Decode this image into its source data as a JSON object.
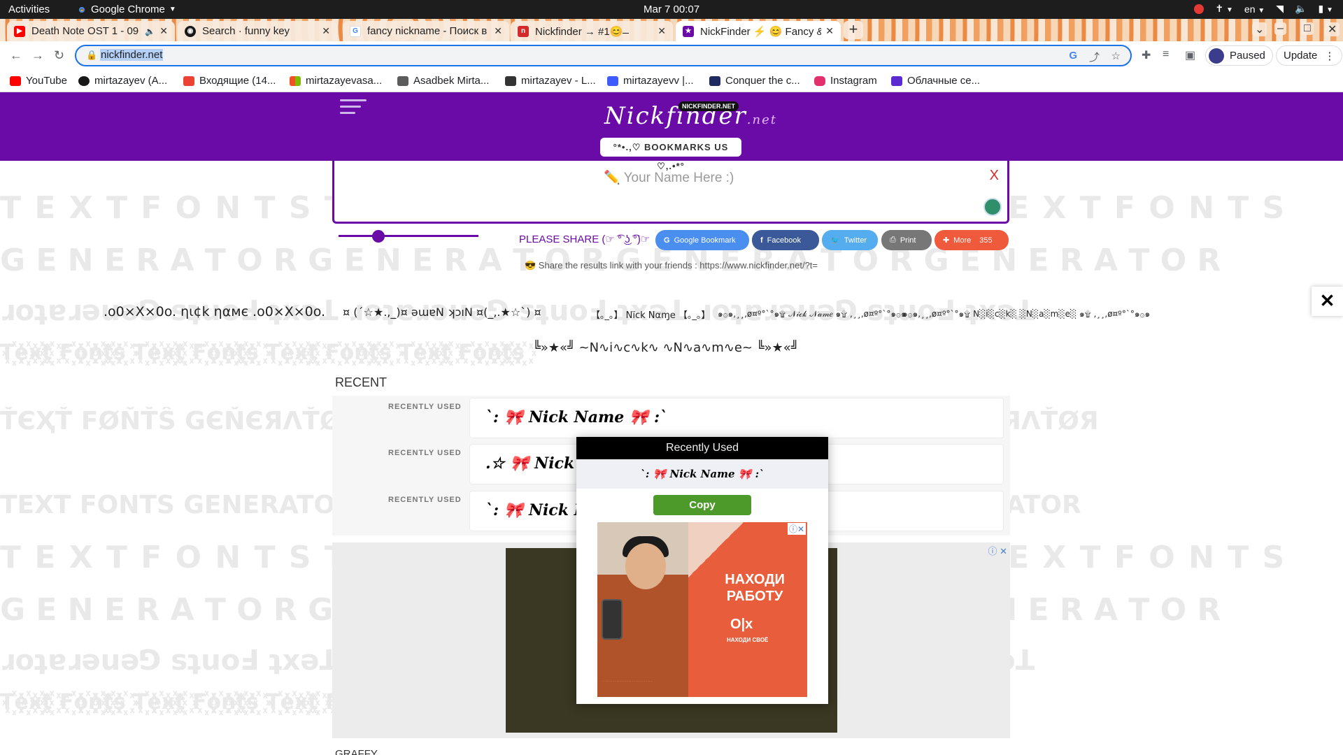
{
  "system_bar": {
    "activities": "Activities",
    "app": "Google Chrome",
    "clock": "Mar 7  00:07",
    "lang": "en"
  },
  "tabs": [
    {
      "title": "Death Note OST 1 - 09",
      "favicon": "youtube-icon",
      "color": "#ff0000",
      "active": false
    },
    {
      "title": "Search · funny key",
      "favicon": "github-icon",
      "color": "#181717",
      "active": false
    },
    {
      "title": "fancy nickname - Поиск в",
      "favicon": "google-icon",
      "color": "#4285f4",
      "active": false
    },
    {
      "title": "Nickfinder → #1😊͏ ̶̶̶̶͏̶̶̶͏",
      "favicon": "nickfinder-icon",
      "color": "#d42a2a",
      "active": false
    },
    {
      "title": "NickFinder ⚡ 😊 Fancy & 5",
      "favicon": "star-icon",
      "color": "#6a0ba8",
      "active": true
    }
  ],
  "toolbar": {
    "url": "nickfinder.net",
    "profile": "Paused",
    "update": "Update"
  },
  "bookmarks": [
    {
      "label": "YouTube",
      "color": "#ff0000"
    },
    {
      "label": "mirtazayev (A...",
      "color": "#181717"
    },
    {
      "label": "Входящие (14...",
      "color": "#ea4335"
    },
    {
      "label": "mirtazayevasa...",
      "color": "#f4b400"
    },
    {
      "label": "Asadbek Mirta...",
      "color": "#5c5c5c"
    },
    {
      "label": "mirtazayev - L...",
      "color": "#333333"
    },
    {
      "label": "mirtazayevv |...",
      "color": "#3d5afe"
    },
    {
      "label": "Conquer the c...",
      "color": "#1f2a60"
    },
    {
      "label": "Instagram",
      "color": "#e1306c"
    },
    {
      "label": "Облачные се...",
      "color": "#5b2bd1"
    }
  ],
  "site": {
    "logo": "Nickfinder",
    "logo_suffix": ".net",
    "logo_badge": "NICKFINDER.NET",
    "bookmark_button": "°*•.,♡ BOOKMARKS US ♡,.•*°",
    "input_placeholder": "✏️ Your Name Here :)",
    "close_x": "X",
    "share_label": "PLEASE SHARE (☞ ͡° ͜ʖ ͡°)☞",
    "share_buttons": [
      {
        "label": "Google Bookmark",
        "icon": "google-icon",
        "color": "#4a8ff0"
      },
      {
        "label": "Facebook",
        "icon": "facebook-icon",
        "color": "#3b5998"
      },
      {
        "label": "Twitter",
        "icon": "twitter-icon",
        "color": "#55acee"
      },
      {
        "label": "Print",
        "icon": "print-icon",
        "color": "#777777"
      },
      {
        "label": "More",
        "icon": "plus-icon",
        "color": "#f05a3c",
        "count": "355"
      }
    ],
    "share_link_text": "😎 Share the results link with your friends : https://www.nickfinder.net/?t=",
    "nicknames_row1": [
      ".o0×X×0o. ηι¢k ηαмє .o0×X×0o.",
      "¤ (´☆★.,_)¤ ǝɯɐN ʞɔıN ¤(_,.★☆`) ¤",
      "【｡_｡】 Nïck Nαɱe 【｡_｡】",
      "๑۞๑,¸¸,ø¤º°`°๑۩ 𝒩𝒾𝒸𝓀 𝒩𝒶𝓂𝑒 ๑۩ ,¸¸,ø¤º°`°๑۞๑",
      "๑۞๑,¸¸,ø¤º°`°๑۩ N░i░c░k░ ░N░a░m░e░ ๑۩ ,¸¸,ø¤º°`°๑۞๑"
    ],
    "nickname_row2": "╚»★«╝ ~N∿i∿c∿k∿ ∿N∿a∿m∿e~ ╚»★«╝",
    "recent_heading": "RECENT",
    "recent_items": [
      {
        "label": "RECENTLY USED",
        "text": "`: 🎀 𝑵𝒊𝒄𝒌 𝑵𝒂𝒎𝒆 🎀 :`"
      },
      {
        "label": "RECENTLY USED",
        "text": ".☆ 🎀 𝑵𝒊𝒄𝒌 𝑵𝒂𝒎𝒆 🎀 ☆."
      },
      {
        "label": "RECENTLY USED",
        "text": "`: 🎀 𝑵𝒊𝒄𝒌 𝑵𝒂𝒎𝒆 🎀 :`"
      }
    ],
    "bottom_heading": "GRAFFY"
  },
  "popup": {
    "title": "Recently Used",
    "nickname": "`: 🎀 𝑵𝒊𝒄𝒌 𝑵𝒂𝒎𝒆 🎀 :`",
    "copy_label": "Copy",
    "ad": {
      "headline": "НАХОДИ РАБОТУ",
      "brand": "O|x",
      "tagline": "НАХОДИ СВОЁ"
    }
  },
  "background_words": {
    "line_a": "T E X T   F O N T S",
    "line_b": "G E N E R A T O R",
    "line_c": "ɹoʇɐɹǝuǝ⅁ sʇuoℲ ʇxǝꓕ",
    "line_d": "T꙰e꙰x꙰t꙰ F꙰o꙰n꙰t꙰s꙰",
    "line_e": "ŤЄҲŤ FØŇŤŜ GЄŇЄЯΛŤØЯ",
    "line_f": "TEXT FONTS GENERATOR"
  }
}
